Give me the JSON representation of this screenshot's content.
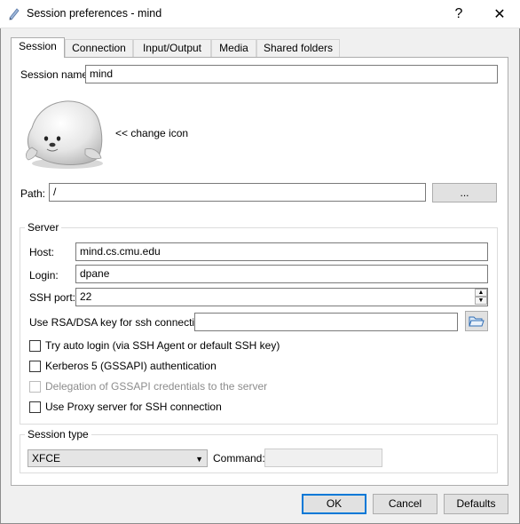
{
  "window": {
    "title": "Session preferences - mind",
    "help_label": "?",
    "close_label": "✕"
  },
  "tabs": [
    {
      "label": "Session"
    },
    {
      "label": "Connection"
    },
    {
      "label": "Input/Output"
    },
    {
      "label": "Media"
    },
    {
      "label": "Shared folders"
    }
  ],
  "session": {
    "name_label": "Session name:",
    "name_value": "mind",
    "change_icon_label": "<< change icon",
    "path_label": "Path:",
    "path_value": "/",
    "browse_label": "..."
  },
  "server": {
    "group_title": "Server",
    "host_label": "Host:",
    "host_value": "mind.cs.cmu.edu",
    "login_label": "Login:",
    "login_value": "dpane",
    "port_label": "SSH port:",
    "port_value": "22",
    "rsa_label": "Use RSA/DSA key for ssh connection:",
    "rsa_value": "",
    "options": [
      {
        "label": "Try auto login (via SSH Agent or default SSH key)",
        "checked": false,
        "enabled": true
      },
      {
        "label": "Kerberos 5 (GSSAPI) authentication",
        "checked": false,
        "enabled": true
      },
      {
        "label": "Delegation of GSSAPI credentials to the server",
        "checked": false,
        "enabled": false
      },
      {
        "label": "Use Proxy server for SSH connection",
        "checked": false,
        "enabled": true
      }
    ]
  },
  "session_type": {
    "group_title": "Session type",
    "selected": "XFCE",
    "command_label": "Command:",
    "command_value": ""
  },
  "footer": {
    "ok_label": "OK",
    "cancel_label": "Cancel",
    "defaults_label": "Defaults"
  }
}
